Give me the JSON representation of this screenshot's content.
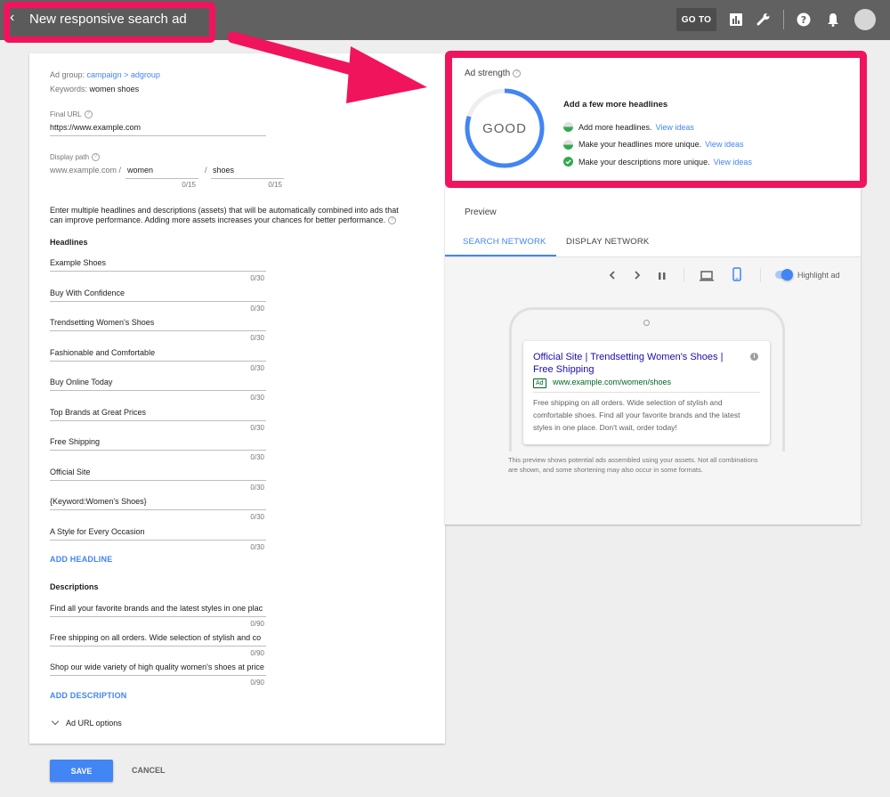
{
  "header": {
    "title": "New responsive search ad",
    "goto_label": "GO TO"
  },
  "form": {
    "ad_group_label": "Ad group:",
    "ad_group_value": "campaign > adgroup",
    "keywords_label": "Keywords:",
    "keywords_value": "women shoes",
    "final_url_label": "Final URL",
    "final_url_value": "https://www.example.com",
    "display_path_label": "Display path",
    "display_path_base": "www.example.com /",
    "path1": "women",
    "path2": "shoes",
    "path_separator": "/",
    "path1_counter": "0/15",
    "path2_counter": "0/15",
    "intro_line1": "Enter multiple headlines and descriptions (assets)  that will be automatically combined into ads that",
    "intro_line2": "can improve performance. Adding more assets increases your chances for better performance.",
    "headlines_title": "Headlines",
    "headlines": [
      {
        "text": "Example Shoes",
        "counter": "0/30"
      },
      {
        "text": "Buy With Confidence",
        "counter": "0/30"
      },
      {
        "text": "Trendsetting Women's Shoes",
        "counter": "0/30"
      },
      {
        "text": "Fashionable and Comfortable",
        "counter": "0/30"
      },
      {
        "text": "Buy Online Today",
        "counter": "0/30"
      },
      {
        "text": "Top Brands at Great Prices",
        "counter": "0/30"
      },
      {
        "text": "Free Shipping",
        "counter": "0/30"
      },
      {
        "text": "Official Site",
        "counter": "0/30"
      },
      {
        "text": "{Keyword:Women's Shoes}",
        "counter": "0/30"
      },
      {
        "text": "A Style for Every Occasion",
        "counter": "0/30"
      }
    ],
    "add_headline": "ADD HEADLINE",
    "descriptions_title": "Descriptions",
    "descriptions": [
      {
        "text": "Find all your favorite brands and the latest styles in one plac",
        "counter": "0/90"
      },
      {
        "text": "Free shipping on all orders. Wide selection of stylish and co",
        "counter": "0/90"
      },
      {
        "text": "Shop our wide variety of high quality women's shoes at price",
        "counter": "0/90"
      }
    ],
    "add_description": "ADD DESCRIPTION",
    "url_options": "Ad URL options"
  },
  "strength": {
    "title": "Ad strength",
    "rating": "GOOD",
    "rating_fraction": 0.8,
    "heading": "Add a few more headlines",
    "items": [
      {
        "text": "Add more headlines.",
        "link": "View ideas",
        "status": "partial"
      },
      {
        "text": "Make your headlines more unique.",
        "link": "View ideas",
        "status": "partial"
      },
      {
        "text": "Make your descriptions more unique.",
        "link": "View ideas",
        "status": "done"
      }
    ]
  },
  "preview": {
    "title": "Preview",
    "tabs": [
      "SEARCH NETWORK",
      "DISPLAY NETWORK"
    ],
    "active_tab": 0,
    "highlight_label": "Highlight ad",
    "highlight_on": true,
    "ad_title_line1": "Official Site | Trendsetting Women's Shoes |",
    "ad_title_line2": "Free Shipping",
    "ad_badge": "Ad",
    "ad_url": "www.example.com/women/shoes",
    "ad_desc_line1": "Free shipping on all orders. Wide selection of stylish and",
    "ad_desc_line2": "comfortable shoes. Find all your favorite brands and the latest",
    "ad_desc_line3": "styles in one place. Don't wait, order today!",
    "note_line1": "This preview shows potential ads assembled using your assets. Not all combinations",
    "note_line2": "are shown, and some shortening may also occur in some formats."
  },
  "actions": {
    "save": "SAVE",
    "cancel": "CANCEL"
  },
  "colors": {
    "highlight": "#f0145c",
    "accent": "#4285f4",
    "success": "#34a853",
    "ad_link": "#1a0dab",
    "ad_url": "#006621"
  }
}
